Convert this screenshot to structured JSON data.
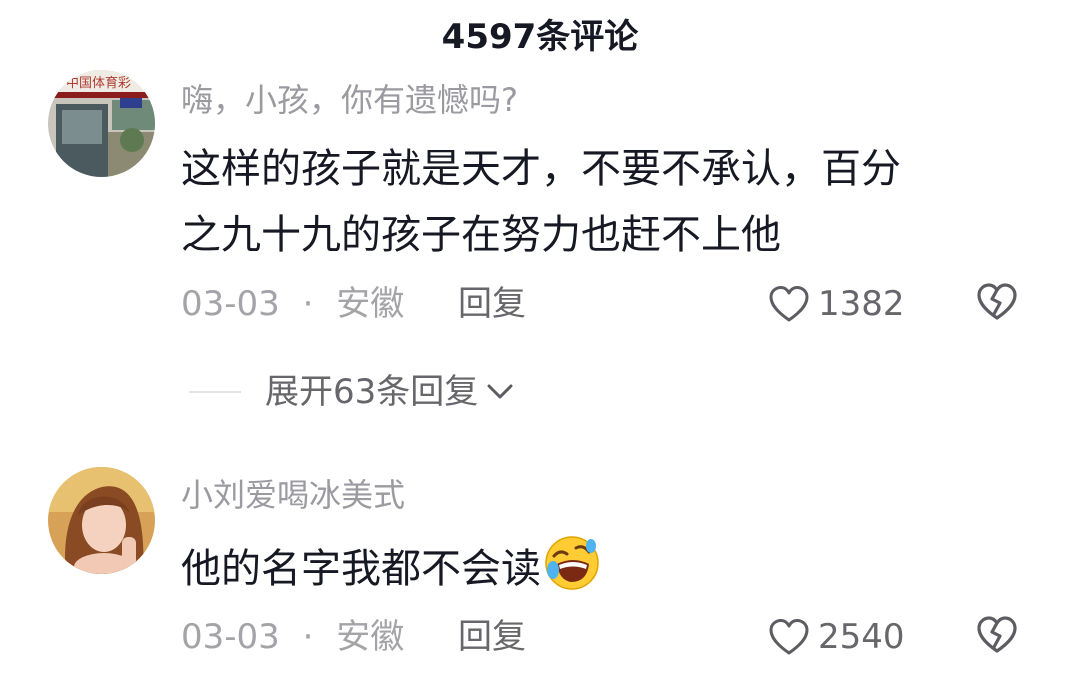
{
  "header": {
    "title": "4597条评论"
  },
  "comments": [
    {
      "username": "嗨，小孩，你有遗憾吗?",
      "avatar_sign": "中国体育彩",
      "text_line1": "这样的孩子就是天才，不要不承认，百分",
      "text_line2": "之九十九的孩子在努力也赶不上他",
      "date": "03-03",
      "location": "安徽",
      "reply_label": "回复",
      "likes": "1382",
      "expand_label": "展开63条回复"
    },
    {
      "username": "小刘爱喝冰美式",
      "text": "他的名字我都不会读",
      "emoji": "rolling-laughing-emoji",
      "date": "03-03",
      "location": "安徽",
      "reply_label": "回复",
      "likes": "2540"
    }
  ],
  "separator": "·",
  "colors": {
    "primary_text": "#161823",
    "secondary_text": "#9a9aa0",
    "action_text": "#66666b"
  }
}
